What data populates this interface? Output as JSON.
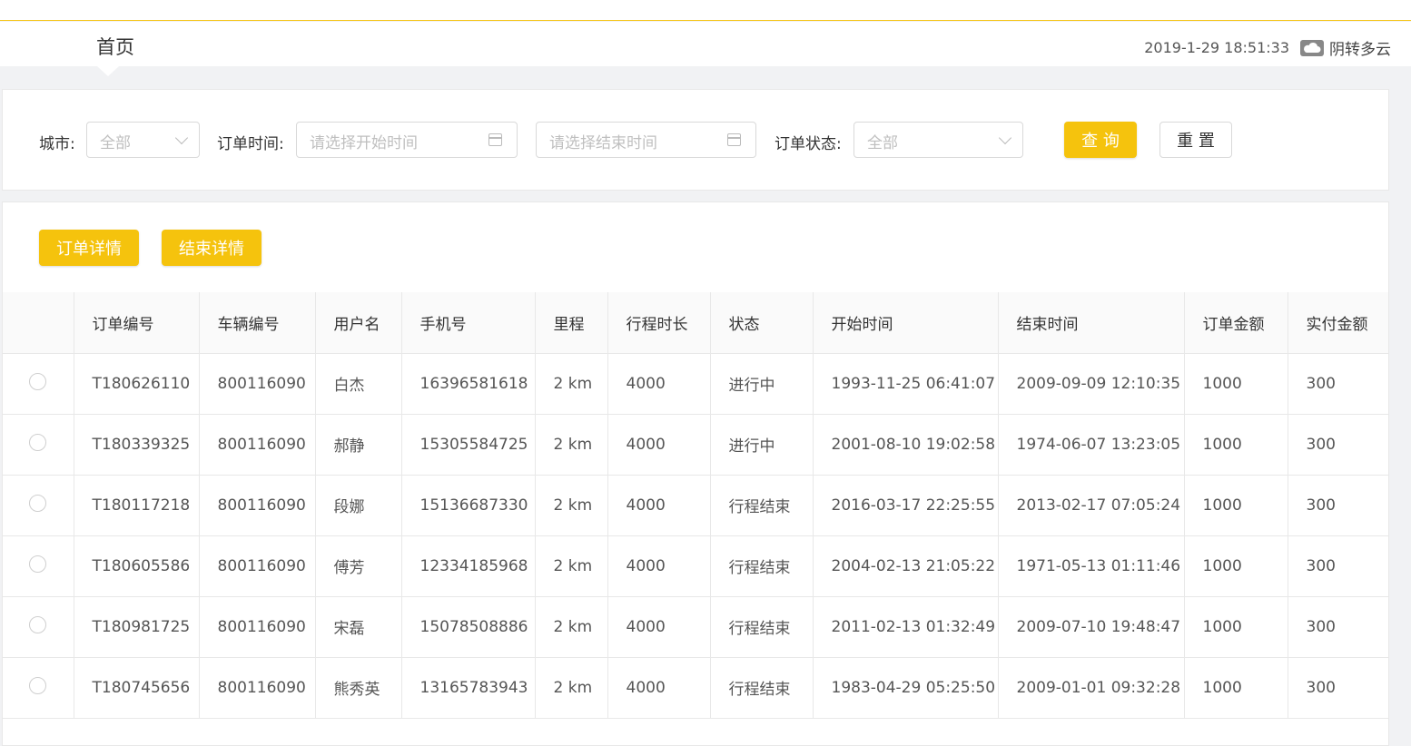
{
  "header": {
    "title": "首页",
    "datetime": "2019-1-29 18:51:33",
    "weather": "阴转多云",
    "weather_icon": "cloud-icon"
  },
  "filters": {
    "city_label": "城市:",
    "city_value": "全部",
    "order_time_label": "订单时间:",
    "start_placeholder": "请选择开始时间",
    "end_placeholder": "请选择结束时间",
    "status_label": "订单状态:",
    "status_value": "全部",
    "query_button": "查 询",
    "reset_button": "重 置"
  },
  "actions": {
    "order_detail": "订单详情",
    "end_detail": "结束详情"
  },
  "colors": {
    "accent": "#f5c30d"
  },
  "table": {
    "columns": [
      "订单编号",
      "车辆编号",
      "用户名",
      "手机号",
      "里程",
      "行程时长",
      "状态",
      "开始时间",
      "结束时间",
      "订单金额",
      "实付金额"
    ],
    "rows": [
      [
        "T180626110",
        "800116090",
        "白杰",
        "16396581618",
        "2 km",
        "4000",
        "进行中",
        "1993-11-25 06:41:07",
        "2009-09-09 12:10:35",
        "1000",
        "300"
      ],
      [
        "T180339325",
        "800116090",
        "郝静",
        "15305584725",
        "2 km",
        "4000",
        "进行中",
        "2001-08-10 19:02:58",
        "1974-06-07 13:23:05",
        "1000",
        "300"
      ],
      [
        "T180117218",
        "800116090",
        "段娜",
        "15136687330",
        "2 km",
        "4000",
        "行程结束",
        "2016-03-17 22:25:55",
        "2013-02-17 07:05:24",
        "1000",
        "300"
      ],
      [
        "T180605586",
        "800116090",
        "傅芳",
        "12334185968",
        "2 km",
        "4000",
        "行程结束",
        "2004-02-13 21:05:22",
        "1971-05-13 01:11:46",
        "1000",
        "300"
      ],
      [
        "T180981725",
        "800116090",
        "宋磊",
        "15078508886",
        "2 km",
        "4000",
        "行程结束",
        "2011-02-13 01:32:49",
        "2009-07-10 19:48:47",
        "1000",
        "300"
      ],
      [
        "T180745656",
        "800116090",
        "熊秀英",
        "13165783943",
        "2 km",
        "4000",
        "行程结束",
        "1983-04-29 05:25:50",
        "2009-01-01 09:32:28",
        "1000",
        "300"
      ]
    ]
  }
}
